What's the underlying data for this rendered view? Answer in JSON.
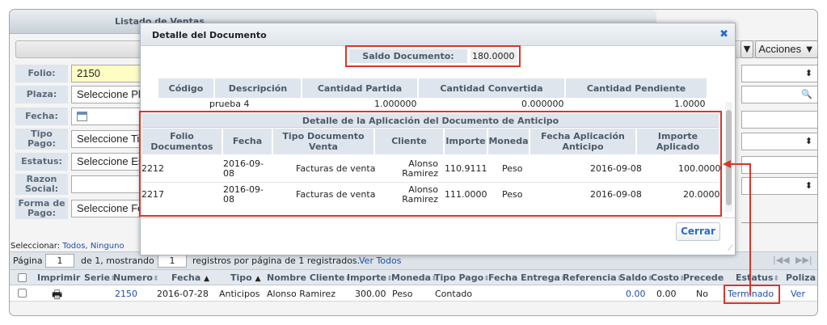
{
  "page": {
    "title": "Listado de Ventas",
    "acciones_label": "Acciones ▼",
    "small_dropdown_label": "▼"
  },
  "filters": {
    "folio_label": "Folio:",
    "folio_value": "2150",
    "plaza_label": "Plaza:",
    "plaza_value": "Seleccione Plaza",
    "fecha_label": "Fecha:",
    "tipo_pago_label": "Tipo Pago:",
    "tipo_pago_value": "Seleccione Tipo",
    "estatus_label": "Estatus:",
    "estatus_value": "Seleccione Estatus",
    "razon_social_label": "Razon Social:",
    "forma_pago_label": "Forma de Pago:",
    "forma_pago_value": "Seleccione Forma"
  },
  "selection": {
    "prefix": "Seleccionar:",
    "todos": "Todos",
    "ninguno": "Ninguno"
  },
  "pagination": {
    "page_label": "Página",
    "page_value": "1",
    "of_label": "de 1, mostrando",
    "per_page_value": "1",
    "suffix": "registros por página de 1 registrados.",
    "ver_todos": "Ver Todos",
    "nav_first": "|◀◀",
    "nav_last": "▶▶|"
  },
  "grid": {
    "headers": {
      "imprimir": "Imprimir",
      "serie": "Serie",
      "numero": "Numero",
      "fecha": "Fecha",
      "tipo": "Tipo",
      "nombre_cliente": "Nombre Cliente",
      "importe": "Importe",
      "moneda": "Moneda",
      "tipo_pago": "Tipo Pago",
      "fecha_entrega": "Fecha Entrega",
      "referencia": "Referencia",
      "saldo": "Saldo",
      "costo": "Costo",
      "precede": "Precede",
      "estatus": "Estatus",
      "poliza": "Poliza"
    },
    "row": {
      "numero": "2150",
      "fecha": "2016-07-28",
      "tipo": "Anticipos",
      "nombre_cliente": "Alonso Ramirez",
      "importe": "300.00",
      "moneda": "Peso",
      "tipo_pago": "Contado",
      "saldo": "0.00",
      "costo": "0.00",
      "precede": "No",
      "estatus": "Terminado",
      "poliza": "Ver"
    }
  },
  "modal": {
    "title": "Detalle del Documento",
    "close_glyph": "✖",
    "saldo_label": "Saldo Documento:",
    "saldo_value": "180.0000",
    "table1": {
      "headers": [
        "Código",
        "Descripción",
        "Cantidad Partida",
        "Cantidad Convertida",
        "Cantidad Pendiente"
      ],
      "row": [
        "",
        "prueba 4",
        "1.000000",
        "0.000000",
        "1.0000"
      ]
    },
    "detalle": {
      "title": "Detalle de la Aplicación del Documento de Anticipo",
      "headers": [
        "Folio Documentos",
        "Fecha",
        "Tipo Documento Venta",
        "Cliente",
        "Importe",
        "Moneda",
        "Fecha Aplicación Anticipo",
        "Importe Aplicado"
      ],
      "rows": [
        {
          "folio": "2212",
          "fecha": "2016-09-08",
          "tipo": "Facturas de venta",
          "cliente": "Alonso Ramirez",
          "importe": "110.9111",
          "moneda": "Peso",
          "fecha_aplicacion": "2016-09-08",
          "importe_aplicado": "100.0000"
        },
        {
          "folio": "2217",
          "fecha": "2016-09-08",
          "tipo": "Facturas de venta",
          "cliente": "Alonso Ramirez",
          "importe": "111.0000",
          "moneda": "Peso",
          "fecha_aplicacion": "2016-09-08",
          "importe_aplicado": "20.0000"
        }
      ]
    },
    "cerrar_label": "Cerrar"
  },
  "colors": {
    "highlight_red": "#d9352a",
    "link_blue": "#1f4fa8",
    "header_gray": "#dfe5ec"
  }
}
